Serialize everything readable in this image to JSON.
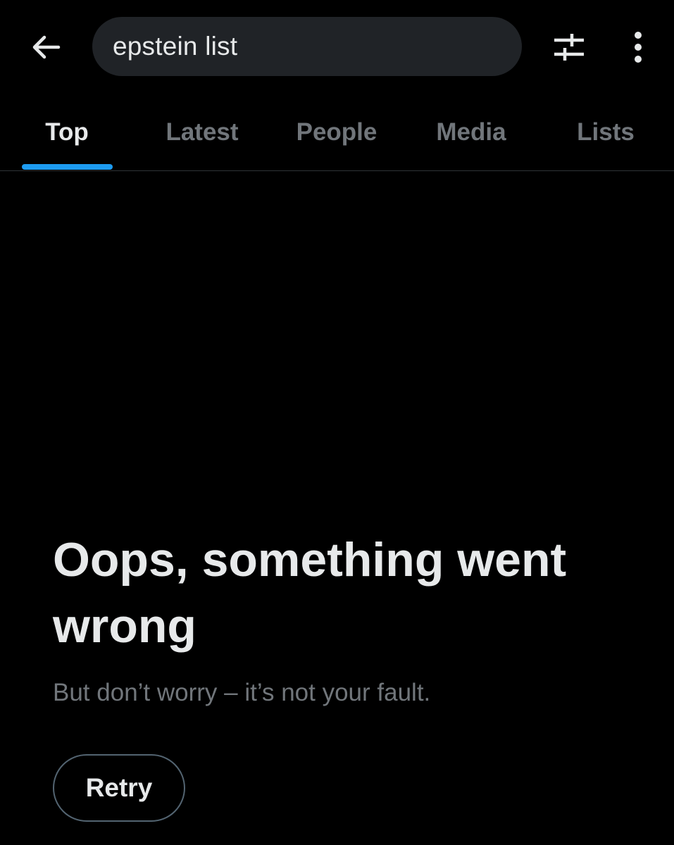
{
  "header": {
    "back_icon": "arrow-left-icon",
    "search_value": "epstein list",
    "filter_icon": "sliders-icon",
    "more_icon": "vertical-dots-icon"
  },
  "tabs": [
    {
      "label": "Top",
      "active": true
    },
    {
      "label": "Latest",
      "active": false
    },
    {
      "label": "People",
      "active": false
    },
    {
      "label": "Media",
      "active": false
    },
    {
      "label": "Lists",
      "active": false
    }
  ],
  "error": {
    "title": "Oops, something went wrong",
    "subtitle": "But don’t worry – it’s not your fault.",
    "retry_label": "Retry"
  },
  "colors": {
    "background": "#000000",
    "accent": "#1d9bf0",
    "primary_text": "#e7e9ea",
    "secondary_text": "#71767b",
    "search_bg": "#202327"
  }
}
